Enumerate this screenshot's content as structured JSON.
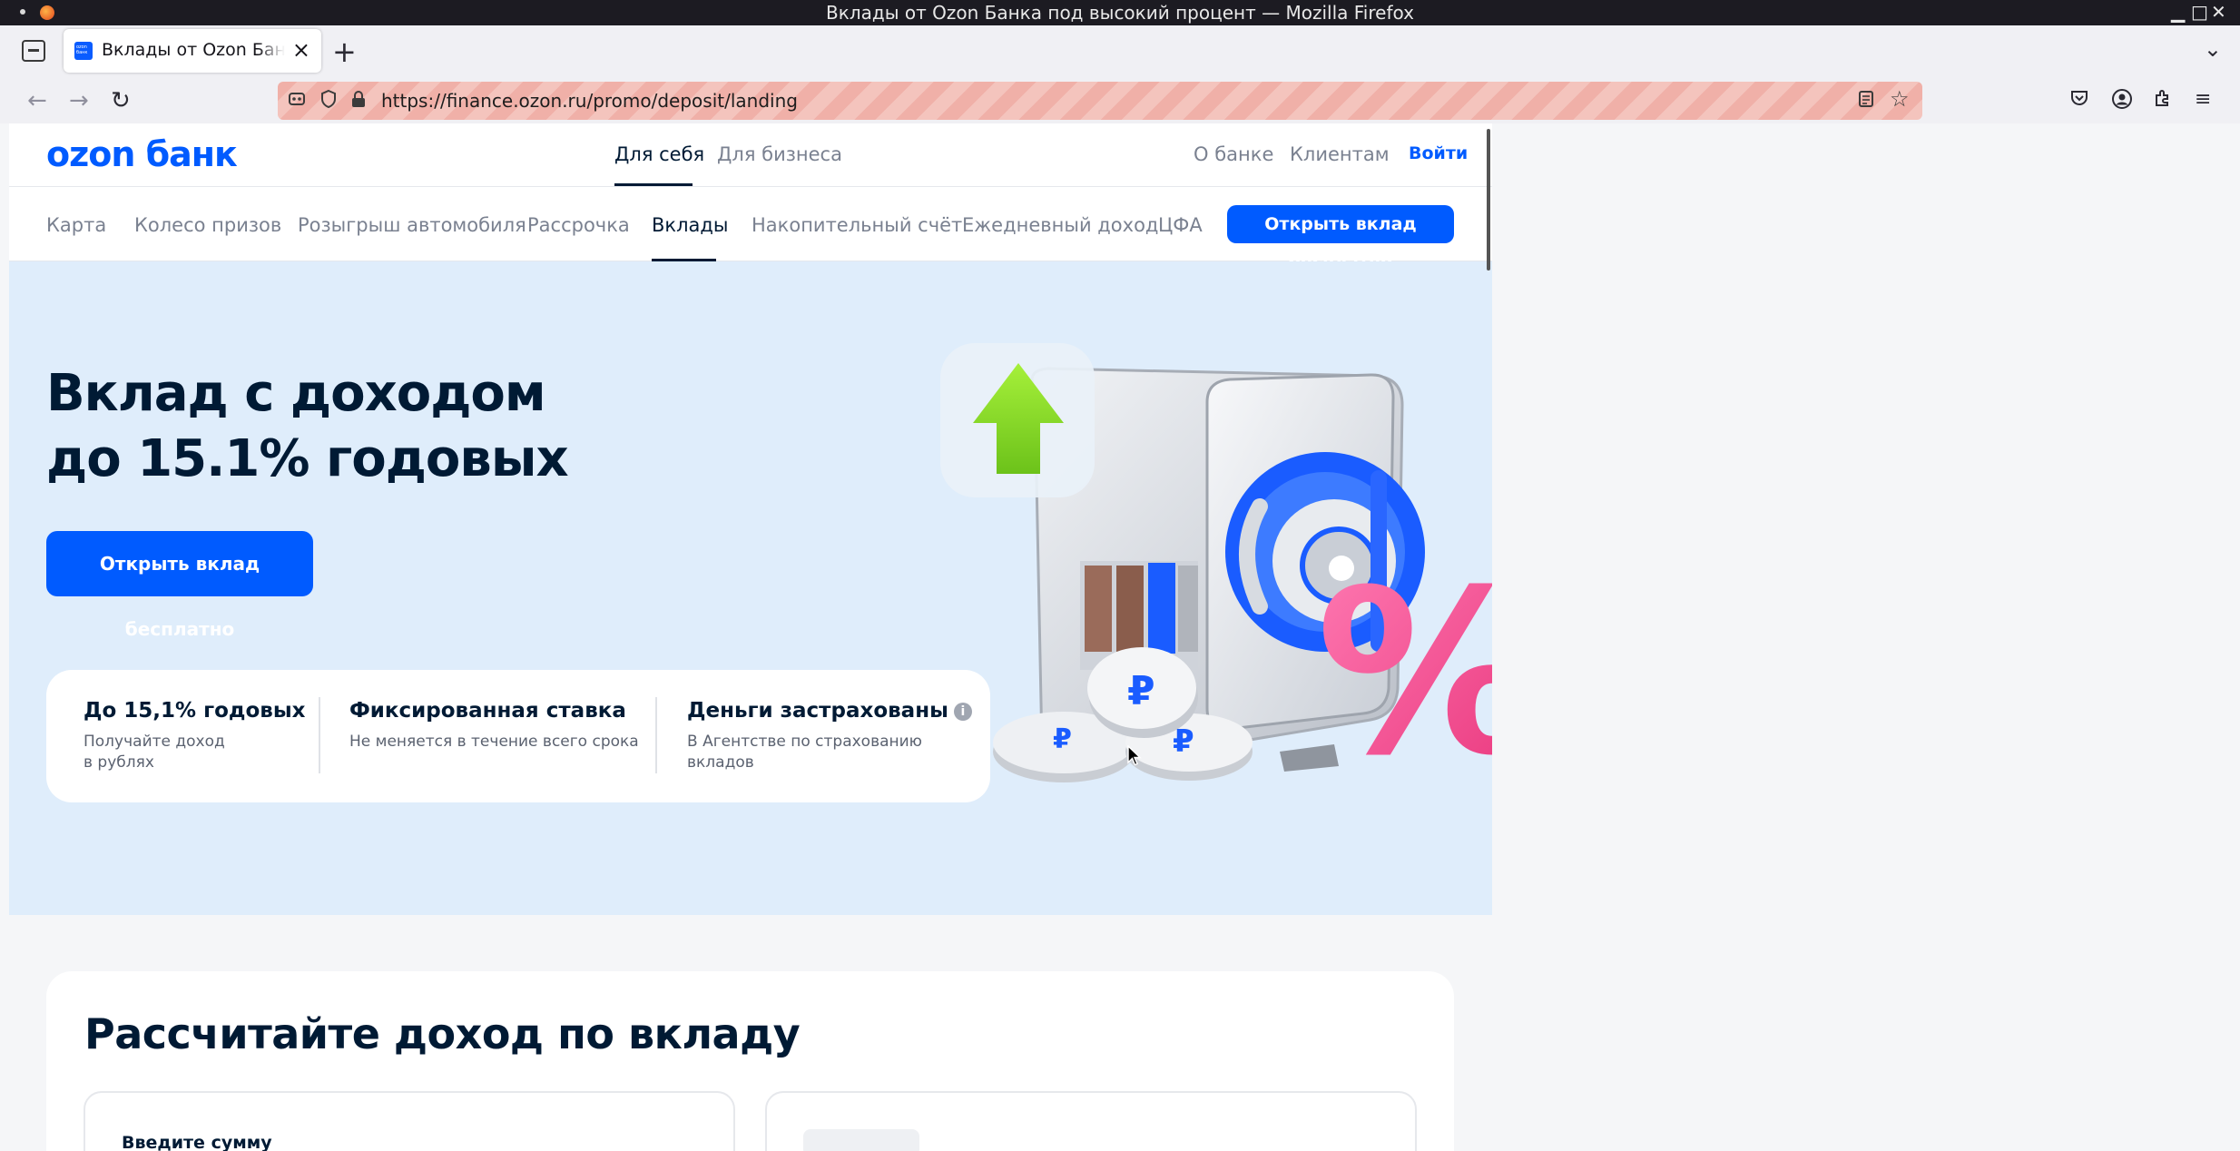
{
  "window": {
    "title": "Вклады от Ozon Банка под высокий процент — Mozilla Firefox",
    "controls": [
      "▁",
      "□",
      "✕"
    ]
  },
  "browser": {
    "tab": {
      "label": "Вклады от Ozon Банка под высокий процент"
    },
    "new_tab_label": "+",
    "url": "https://finance.ozon.ru/promo/deposit/landing"
  },
  "site": {
    "logo": "ozon банк",
    "header_links": [
      "Для себя",
      "Для бизнеса"
    ],
    "header_right_links": [
      "О банке",
      "Клиентам"
    ],
    "login": "Войти",
    "sub_nav": [
      "Карта",
      "Колесо призов",
      "Розыгрыш автомобиля",
      "Рассрочка",
      "Вклады",
      "Накопительный счёт",
      "Ежедневный доход",
      "ЦФА"
    ],
    "sub_nav_cta": "Открыть вклад бесплатно"
  },
  "hero": {
    "title_line1": "Вклад с доходом",
    "title_line2": "до 15.1% годовых",
    "cta": "Открыть вклад бесплатно",
    "features": [
      {
        "title": "До 15,1% годовых",
        "desc_line1": "Получайте доход",
        "desc_line2": "в рублях"
      },
      {
        "title": "Фиксированная ставка",
        "desc_line1": "Не меняется в течение всего срока",
        "desc_line2": ""
      },
      {
        "title": "Деньги застрахованы",
        "desc_line1": "В Агентстве по страхованию",
        "desc_line2": "вкладов"
      }
    ],
    "info_icon_glyph": "i",
    "illustration_percent": "%",
    "coin_glyph": "₽"
  },
  "calculator": {
    "title": "Рассчитайте доход по вкладу",
    "amount_label": "Введите сумму"
  },
  "colors": {
    "brand": "#005bff",
    "text": "#001a34",
    "hero_bg": "#dfedfb",
    "percent_pink": "#f0468c",
    "arrow_green": "#8ee02a"
  }
}
